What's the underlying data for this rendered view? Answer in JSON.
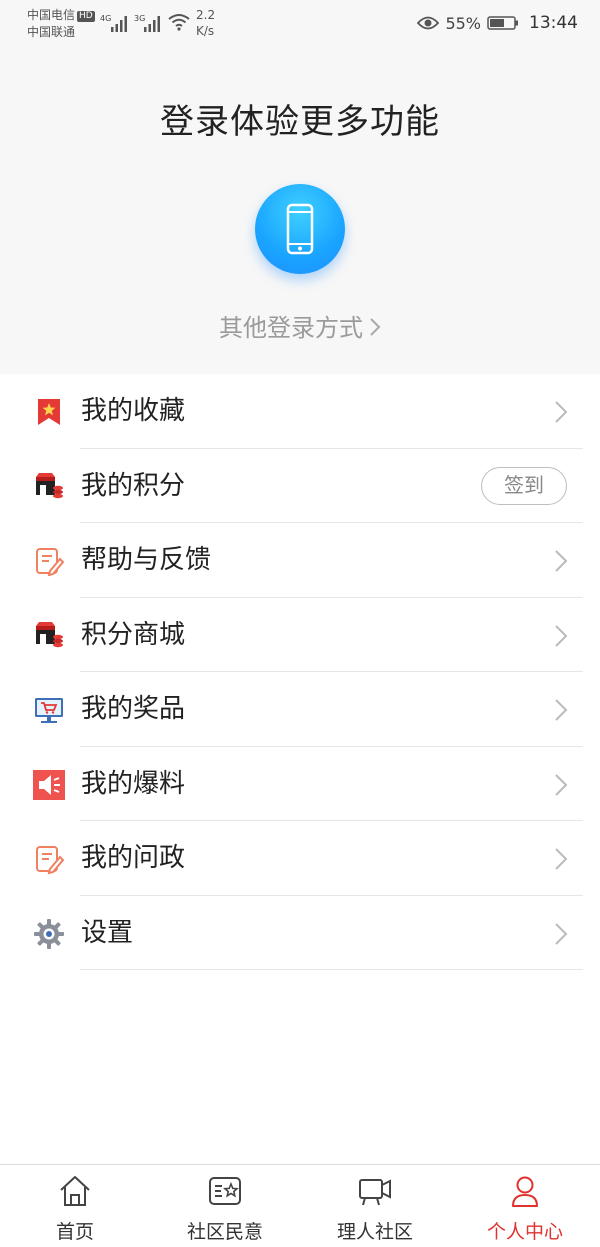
{
  "status_bar": {
    "carrier1": "中国电信",
    "hd": "HD",
    "carrier2": "中国联通",
    "net1": "4G",
    "net2": "3G",
    "speed_value": "2.2",
    "speed_unit": "K/s",
    "battery": "55%",
    "time": "13:44"
  },
  "login": {
    "title": "登录体验更多功能",
    "other_login": "其他登录方式"
  },
  "menu": {
    "items": [
      {
        "label": "我的收藏",
        "icon": "bookmark-star-icon"
      },
      {
        "label": "我的积分",
        "icon": "points-shop-icon",
        "action": "签到"
      },
      {
        "label": "帮助与反馈",
        "icon": "edit-note-icon"
      },
      {
        "label": "积分商城",
        "icon": "points-shop-icon"
      },
      {
        "label": "我的奖品",
        "icon": "monitor-cart-icon"
      },
      {
        "label": "我的爆料",
        "icon": "speaker-icon"
      },
      {
        "label": "我的问政",
        "icon": "edit-note-icon"
      },
      {
        "label": "设置",
        "icon": "gear-icon"
      }
    ]
  },
  "tabs": [
    {
      "label": "首页",
      "icon": "home-icon"
    },
    {
      "label": "社区民意",
      "icon": "star-card-icon"
    },
    {
      "label": "理人社区",
      "icon": "video-camera-icon"
    },
    {
      "label": "个人中心",
      "icon": "user-icon",
      "active": true
    }
  ],
  "colors": {
    "accent": "#e0322e",
    "login_button": "#19a4ff",
    "header_bg": "#f7f7f7"
  }
}
